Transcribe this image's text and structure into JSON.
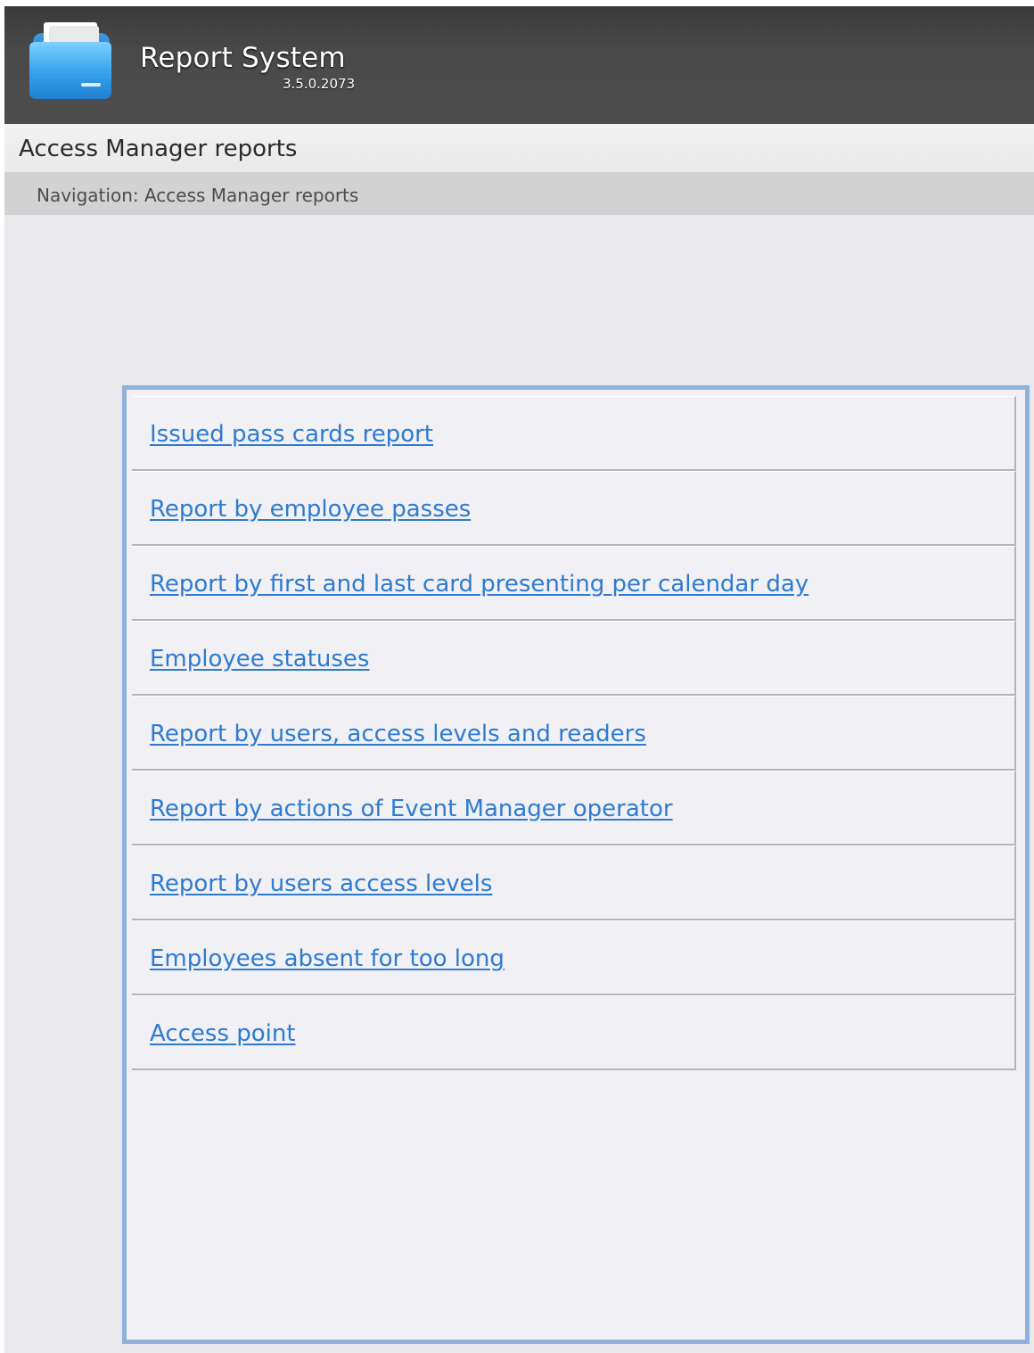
{
  "app": {
    "title": "Report System",
    "version": "3.5.0.2073",
    "logo_icon": "folder-icon"
  },
  "page_title": "Access Manager reports",
  "navigation": {
    "text": "Navigation: Access Manager reports"
  },
  "reports": [
    {
      "label": "Issued pass cards report"
    },
    {
      "label": "Report by employee passes"
    },
    {
      "label": "Report by first and last card presenting per calendar day"
    },
    {
      "label": "Employee statuses"
    },
    {
      "label": "Report by users, access levels and readers"
    },
    {
      "label": "Report by actions of Event Manager operator"
    },
    {
      "label": "Report by users access levels"
    },
    {
      "label": "Employees absent for too long"
    },
    {
      "label": "Access point"
    }
  ],
  "colors": {
    "header_bg": "#4a4a4a",
    "link": "#2e7bcf",
    "panel_border": "#8fb1dc"
  }
}
